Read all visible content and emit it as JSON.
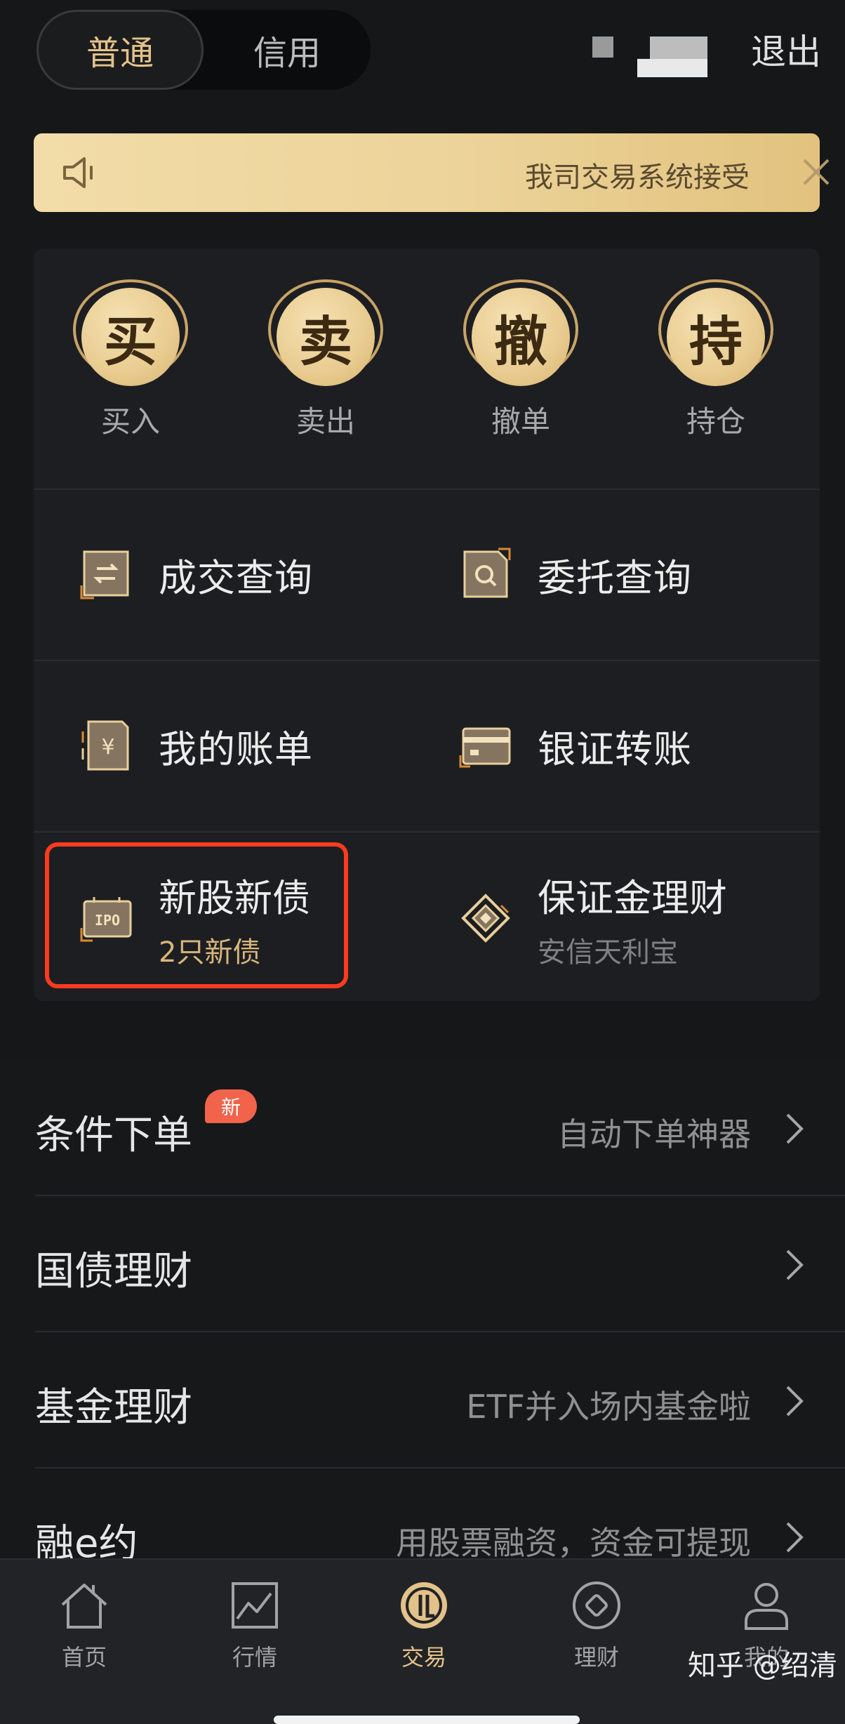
{
  "top": {
    "mode_tabs": [
      "普通",
      "信用"
    ],
    "active_mode": "普通",
    "logout_label": "退出"
  },
  "notice": {
    "text": "我司交易系统接受",
    "close_icon": "close-icon",
    "speaker_icon": "speaker-icon"
  },
  "quick_actions": [
    {
      "glyph": "买",
      "label": "买入",
      "icon": "buy-coin-icon"
    },
    {
      "glyph": "卖",
      "label": "卖出",
      "icon": "sell-coin-icon"
    },
    {
      "glyph": "撤",
      "label": "撤单",
      "icon": "cancel-order-coin-icon"
    },
    {
      "glyph": "持",
      "label": "持仓",
      "icon": "positions-coin-icon"
    }
  ],
  "menu": {
    "deal_query": "成交查询",
    "order_query": "委托查询",
    "my_bill": "我的账单",
    "bank_transfer": "银证转账",
    "ipo": {
      "title": "新股新债",
      "subtitle": "2只新债"
    },
    "margin_finance": {
      "title": "保证金理财",
      "subtitle": "安信天利宝"
    }
  },
  "list": [
    {
      "label": "条件下单",
      "badge": "新",
      "hint": "自动下单神器"
    },
    {
      "label": "国债理财",
      "badge": "",
      "hint": ""
    },
    {
      "label": "基金理财",
      "badge": "",
      "hint": "ETF并入场内基金啦"
    },
    {
      "label": "融e约",
      "badge": "",
      "hint": "用股票融资，资金可提现"
    }
  ],
  "tabs": [
    {
      "label": "首页",
      "icon": "home-icon"
    },
    {
      "label": "行情",
      "icon": "market-chart-icon"
    },
    {
      "label": "交易",
      "icon": "trade-icon",
      "active": true
    },
    {
      "label": "理财",
      "icon": "wealth-icon"
    },
    {
      "label": "我的",
      "icon": "profile-icon"
    }
  ],
  "watermark": "知乎 @绍清",
  "colors": {
    "background": "#161719",
    "gold": "#e3c28a",
    "highlight_red": "#ff3b1f",
    "badge_red": "#f1634b"
  }
}
